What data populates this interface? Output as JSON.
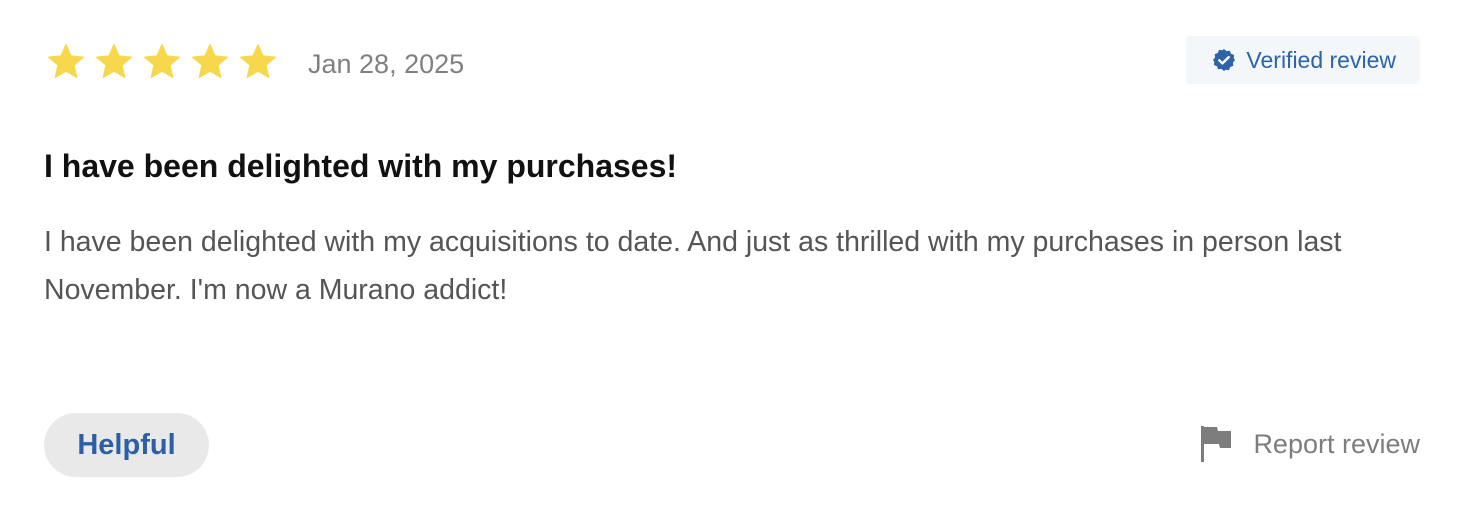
{
  "review": {
    "rating": 5,
    "rating_max": 5,
    "star_color": "#f7d84d",
    "date": "Jan 28, 2025",
    "verified": {
      "label": "Verified review",
      "icon": "verified-check-icon",
      "color": "#2d63a8"
    },
    "title": "I have been delighted with my purchases!",
    "body": "I have been delighted with my acquisitions to date. And just as thrilled with my purchases in person last November. I'm now a Murano addict!"
  },
  "actions": {
    "helpful_label": "Helpful",
    "report_label": "Report review",
    "report_icon": "flag-icon"
  }
}
